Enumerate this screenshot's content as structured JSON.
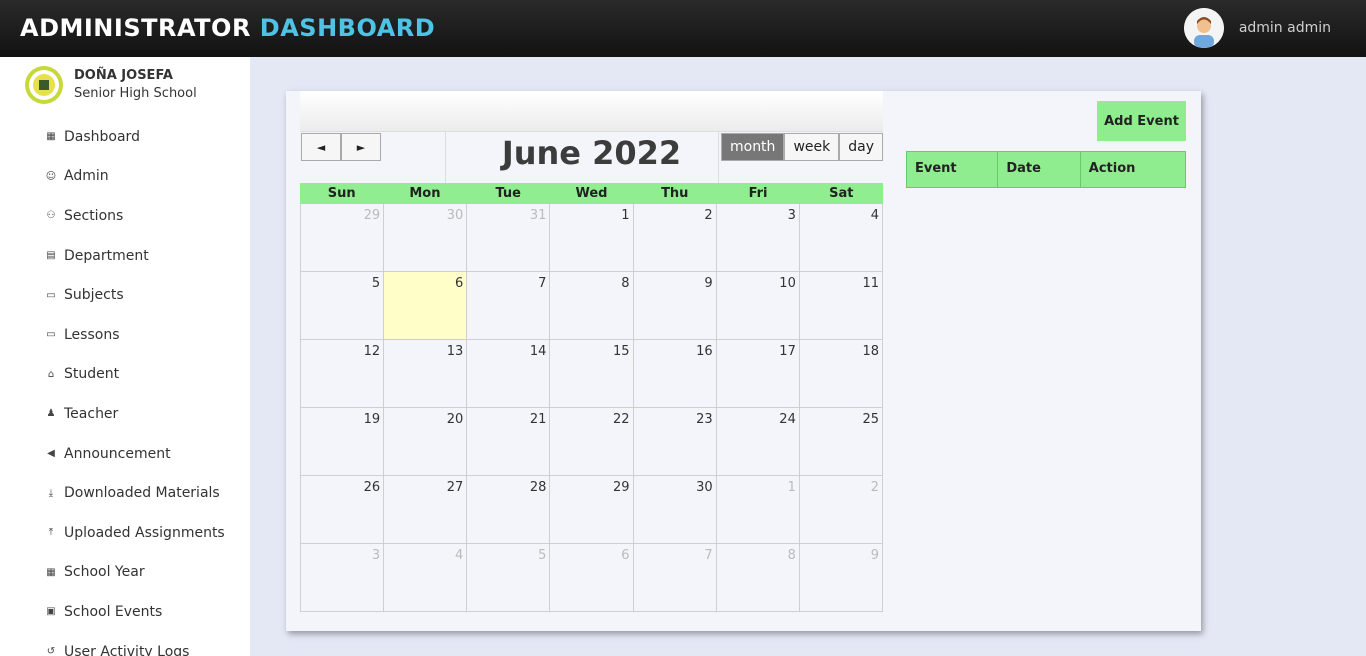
{
  "header": {
    "title_part1": "ADMINISTRATOR",
    "title_part2": "DASHBOARD",
    "user_name": "admin admin",
    "accent_color": "#4dc4e6"
  },
  "sidebar": {
    "school_line1": "DOÑA JOSEFA",
    "school_line2": "Senior High School",
    "items": [
      {
        "label": "Dashboard",
        "icon": "dashboard-icon"
      },
      {
        "label": "Admin",
        "icon": "user-circle-icon"
      },
      {
        "label": "Sections",
        "icon": "users-icon"
      },
      {
        "label": "Department",
        "icon": "building-icon"
      },
      {
        "label": "Subjects",
        "icon": "book-icon"
      },
      {
        "label": "Lessons",
        "icon": "book-icon"
      },
      {
        "label": "Student",
        "icon": "graduation-cap-icon"
      },
      {
        "label": "Teacher",
        "icon": "person-icon"
      },
      {
        "label": "Announcement",
        "icon": "megaphone-icon"
      },
      {
        "label": "Downloaded Materials",
        "icon": "download-icon"
      },
      {
        "label": "Uploaded Assignments",
        "icon": "upload-icon"
      },
      {
        "label": "School Year",
        "icon": "calendar-icon"
      },
      {
        "label": "School Events",
        "icon": "calendar-check-icon"
      },
      {
        "label": "User Activity Logs",
        "icon": "history-icon"
      }
    ]
  },
  "calendar": {
    "prev": "◄",
    "next": "►",
    "title": "June 2022",
    "views": [
      "month",
      "week",
      "day"
    ],
    "active_view": "month",
    "days_of_week": [
      "Sun",
      "Mon",
      "Tue",
      "Wed",
      "Thu",
      "Fri",
      "Sat"
    ],
    "weeks": [
      [
        "29",
        "30",
        "31",
        "1",
        "2",
        "3",
        "4"
      ],
      [
        "5",
        "6",
        "7",
        "8",
        "9",
        "10",
        "11"
      ],
      [
        "12",
        "13",
        "14",
        "15",
        "16",
        "17",
        "18"
      ],
      [
        "19",
        "20",
        "21",
        "22",
        "23",
        "24",
        "25"
      ],
      [
        "26",
        "27",
        "28",
        "29",
        "30",
        "1",
        "2"
      ],
      [
        "3",
        "4",
        "5",
        "6",
        "7",
        "8",
        "9"
      ]
    ],
    "today": "6",
    "highlight_color": "#90ee90"
  },
  "events": {
    "add_label": "Add Event",
    "columns": [
      "Event",
      "Date",
      "Action"
    ]
  }
}
